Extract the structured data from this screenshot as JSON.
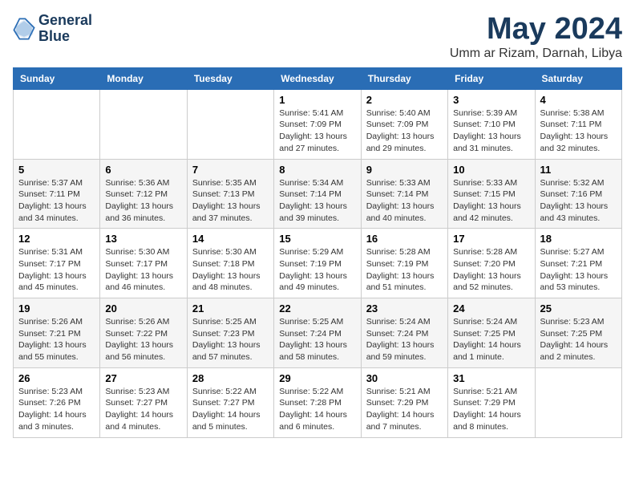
{
  "header": {
    "logo_line1": "General",
    "logo_line2": "Blue",
    "month_year": "May 2024",
    "location": "Umm ar Rizam, Darnah, Libya"
  },
  "weekdays": [
    "Sunday",
    "Monday",
    "Tuesday",
    "Wednesday",
    "Thursday",
    "Friday",
    "Saturday"
  ],
  "weeks": [
    [
      {
        "day": "",
        "sunrise": "",
        "sunset": "",
        "daylight": ""
      },
      {
        "day": "",
        "sunrise": "",
        "sunset": "",
        "daylight": ""
      },
      {
        "day": "",
        "sunrise": "",
        "sunset": "",
        "daylight": ""
      },
      {
        "day": "1",
        "sunrise": "Sunrise: 5:41 AM",
        "sunset": "Sunset: 7:09 PM",
        "daylight": "Daylight: 13 hours and 27 minutes."
      },
      {
        "day": "2",
        "sunrise": "Sunrise: 5:40 AM",
        "sunset": "Sunset: 7:09 PM",
        "daylight": "Daylight: 13 hours and 29 minutes."
      },
      {
        "day": "3",
        "sunrise": "Sunrise: 5:39 AM",
        "sunset": "Sunset: 7:10 PM",
        "daylight": "Daylight: 13 hours and 31 minutes."
      },
      {
        "day": "4",
        "sunrise": "Sunrise: 5:38 AM",
        "sunset": "Sunset: 7:11 PM",
        "daylight": "Daylight: 13 hours and 32 minutes."
      }
    ],
    [
      {
        "day": "5",
        "sunrise": "Sunrise: 5:37 AM",
        "sunset": "Sunset: 7:11 PM",
        "daylight": "Daylight: 13 hours and 34 minutes."
      },
      {
        "day": "6",
        "sunrise": "Sunrise: 5:36 AM",
        "sunset": "Sunset: 7:12 PM",
        "daylight": "Daylight: 13 hours and 36 minutes."
      },
      {
        "day": "7",
        "sunrise": "Sunrise: 5:35 AM",
        "sunset": "Sunset: 7:13 PM",
        "daylight": "Daylight: 13 hours and 37 minutes."
      },
      {
        "day": "8",
        "sunrise": "Sunrise: 5:34 AM",
        "sunset": "Sunset: 7:14 PM",
        "daylight": "Daylight: 13 hours and 39 minutes."
      },
      {
        "day": "9",
        "sunrise": "Sunrise: 5:33 AM",
        "sunset": "Sunset: 7:14 PM",
        "daylight": "Daylight: 13 hours and 40 minutes."
      },
      {
        "day": "10",
        "sunrise": "Sunrise: 5:33 AM",
        "sunset": "Sunset: 7:15 PM",
        "daylight": "Daylight: 13 hours and 42 minutes."
      },
      {
        "day": "11",
        "sunrise": "Sunrise: 5:32 AM",
        "sunset": "Sunset: 7:16 PM",
        "daylight": "Daylight: 13 hours and 43 minutes."
      }
    ],
    [
      {
        "day": "12",
        "sunrise": "Sunrise: 5:31 AM",
        "sunset": "Sunset: 7:17 PM",
        "daylight": "Daylight: 13 hours and 45 minutes."
      },
      {
        "day": "13",
        "sunrise": "Sunrise: 5:30 AM",
        "sunset": "Sunset: 7:17 PM",
        "daylight": "Daylight: 13 hours and 46 minutes."
      },
      {
        "day": "14",
        "sunrise": "Sunrise: 5:30 AM",
        "sunset": "Sunset: 7:18 PM",
        "daylight": "Daylight: 13 hours and 48 minutes."
      },
      {
        "day": "15",
        "sunrise": "Sunrise: 5:29 AM",
        "sunset": "Sunset: 7:19 PM",
        "daylight": "Daylight: 13 hours and 49 minutes."
      },
      {
        "day": "16",
        "sunrise": "Sunrise: 5:28 AM",
        "sunset": "Sunset: 7:19 PM",
        "daylight": "Daylight: 13 hours and 51 minutes."
      },
      {
        "day": "17",
        "sunrise": "Sunrise: 5:28 AM",
        "sunset": "Sunset: 7:20 PM",
        "daylight": "Daylight: 13 hours and 52 minutes."
      },
      {
        "day": "18",
        "sunrise": "Sunrise: 5:27 AM",
        "sunset": "Sunset: 7:21 PM",
        "daylight": "Daylight: 13 hours and 53 minutes."
      }
    ],
    [
      {
        "day": "19",
        "sunrise": "Sunrise: 5:26 AM",
        "sunset": "Sunset: 7:21 PM",
        "daylight": "Daylight: 13 hours and 55 minutes."
      },
      {
        "day": "20",
        "sunrise": "Sunrise: 5:26 AM",
        "sunset": "Sunset: 7:22 PM",
        "daylight": "Daylight: 13 hours and 56 minutes."
      },
      {
        "day": "21",
        "sunrise": "Sunrise: 5:25 AM",
        "sunset": "Sunset: 7:23 PM",
        "daylight": "Daylight: 13 hours and 57 minutes."
      },
      {
        "day": "22",
        "sunrise": "Sunrise: 5:25 AM",
        "sunset": "Sunset: 7:24 PM",
        "daylight": "Daylight: 13 hours and 58 minutes."
      },
      {
        "day": "23",
        "sunrise": "Sunrise: 5:24 AM",
        "sunset": "Sunset: 7:24 PM",
        "daylight": "Daylight: 13 hours and 59 minutes."
      },
      {
        "day": "24",
        "sunrise": "Sunrise: 5:24 AM",
        "sunset": "Sunset: 7:25 PM",
        "daylight": "Daylight: 14 hours and 1 minute."
      },
      {
        "day": "25",
        "sunrise": "Sunrise: 5:23 AM",
        "sunset": "Sunset: 7:25 PM",
        "daylight": "Daylight: 14 hours and 2 minutes."
      }
    ],
    [
      {
        "day": "26",
        "sunrise": "Sunrise: 5:23 AM",
        "sunset": "Sunset: 7:26 PM",
        "daylight": "Daylight: 14 hours and 3 minutes."
      },
      {
        "day": "27",
        "sunrise": "Sunrise: 5:23 AM",
        "sunset": "Sunset: 7:27 PM",
        "daylight": "Daylight: 14 hours and 4 minutes."
      },
      {
        "day": "28",
        "sunrise": "Sunrise: 5:22 AM",
        "sunset": "Sunset: 7:27 PM",
        "daylight": "Daylight: 14 hours and 5 minutes."
      },
      {
        "day": "29",
        "sunrise": "Sunrise: 5:22 AM",
        "sunset": "Sunset: 7:28 PM",
        "daylight": "Daylight: 14 hours and 6 minutes."
      },
      {
        "day": "30",
        "sunrise": "Sunrise: 5:21 AM",
        "sunset": "Sunset: 7:29 PM",
        "daylight": "Daylight: 14 hours and 7 minutes."
      },
      {
        "day": "31",
        "sunrise": "Sunrise: 5:21 AM",
        "sunset": "Sunset: 7:29 PM",
        "daylight": "Daylight: 14 hours and 8 minutes."
      },
      {
        "day": "",
        "sunrise": "",
        "sunset": "",
        "daylight": ""
      }
    ]
  ]
}
